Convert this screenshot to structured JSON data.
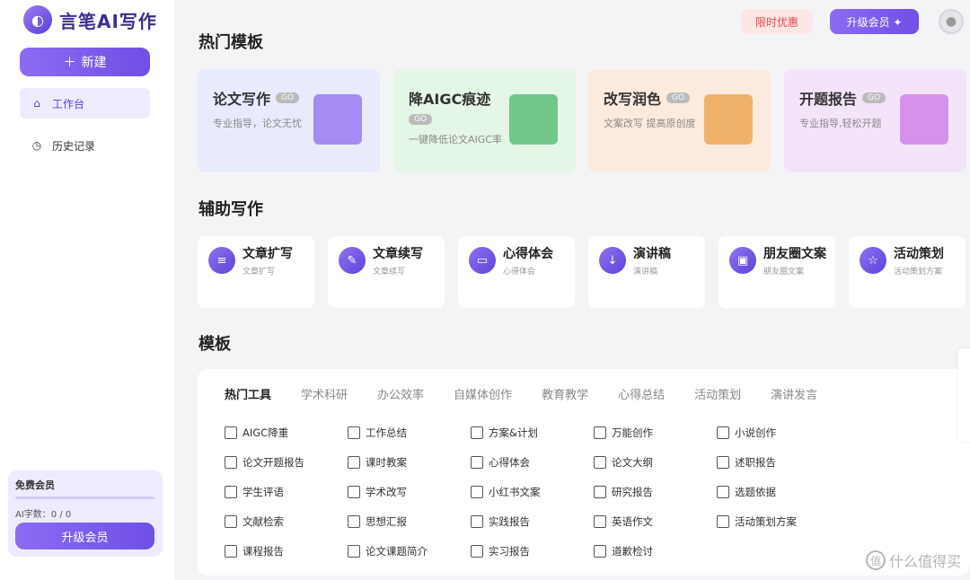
{
  "app": {
    "title": "言笔AI写作"
  },
  "sidebar": {
    "new_label": "新建",
    "items": [
      {
        "label": "工作台",
        "icon": "home-icon",
        "active": true
      },
      {
        "label": "历史记录",
        "icon": "clock-icon",
        "active": false
      }
    ],
    "member": {
      "title": "免费会员",
      "count": "AI字数：0 / 0",
      "upgrade_label": "升级会员"
    }
  },
  "topbar": {
    "promo_label": "限时优惠",
    "upgrade_label": "升级会员 ✦"
  },
  "hot": {
    "title": "热门模板",
    "go": "GO",
    "cards": [
      {
        "title": "论文写作",
        "sub": "专业指导，论文无忧",
        "bg": "#e8ebfb",
        "art": "#a58bf2"
      },
      {
        "title": "降AIGC痕迹",
        "sub": "一键降低论文AIGC率",
        "bg": "#e4f6e5",
        "art": "#6fc88a"
      },
      {
        "title": "改写润色",
        "sub": "文案改写 提高原创度",
        "bg": "#fcebdd",
        "art": "#f0b26b"
      },
      {
        "title": "开题报告",
        "sub": "专业指导,轻松开题",
        "bg": "#f3e4fa",
        "art": "#d691ea"
      }
    ]
  },
  "assist": {
    "title": "辅助写作",
    "cards": [
      {
        "title": "文章扩写",
        "sub": "文章扩写",
        "icon": "expand-icon"
      },
      {
        "title": "文章续写",
        "sub": "文章续写",
        "icon": "pen-icon"
      },
      {
        "title": "心得体会",
        "sub": "心得体会",
        "icon": "chat-icon"
      },
      {
        "title": "演讲稿",
        "sub": "演讲稿",
        "icon": "speech-icon"
      },
      {
        "title": "朋友圈文案",
        "sub": "朋友圈文案",
        "icon": "image-icon"
      },
      {
        "title": "活动策划",
        "sub": "活动策划方案",
        "icon": "star-icon"
      }
    ]
  },
  "templates": {
    "title": "模板",
    "tabs": [
      "热门工具",
      "学术科研",
      "办公效率",
      "自媒体创作",
      "教育教学",
      "心得总结",
      "活动策划",
      "演讲发言"
    ],
    "items": [
      "AIGC降重",
      "工作总结",
      "方案&计划",
      "万能创作",
      "小说创作",
      "论文开题报告",
      "课时教案",
      "心得体会",
      "论文大纲",
      "述职报告",
      "学生评语",
      "学术改写",
      "小红书文案",
      "研究报告",
      "选题依据",
      "文献检索",
      "思想汇报",
      "实践报告",
      "英语作文",
      "活动策划方案",
      "课程报告",
      "论文课题简介",
      "实习报告",
      "道歉检讨"
    ]
  },
  "watermark": {
    "text": "什么值得买",
    "icon_glyph": "值"
  }
}
